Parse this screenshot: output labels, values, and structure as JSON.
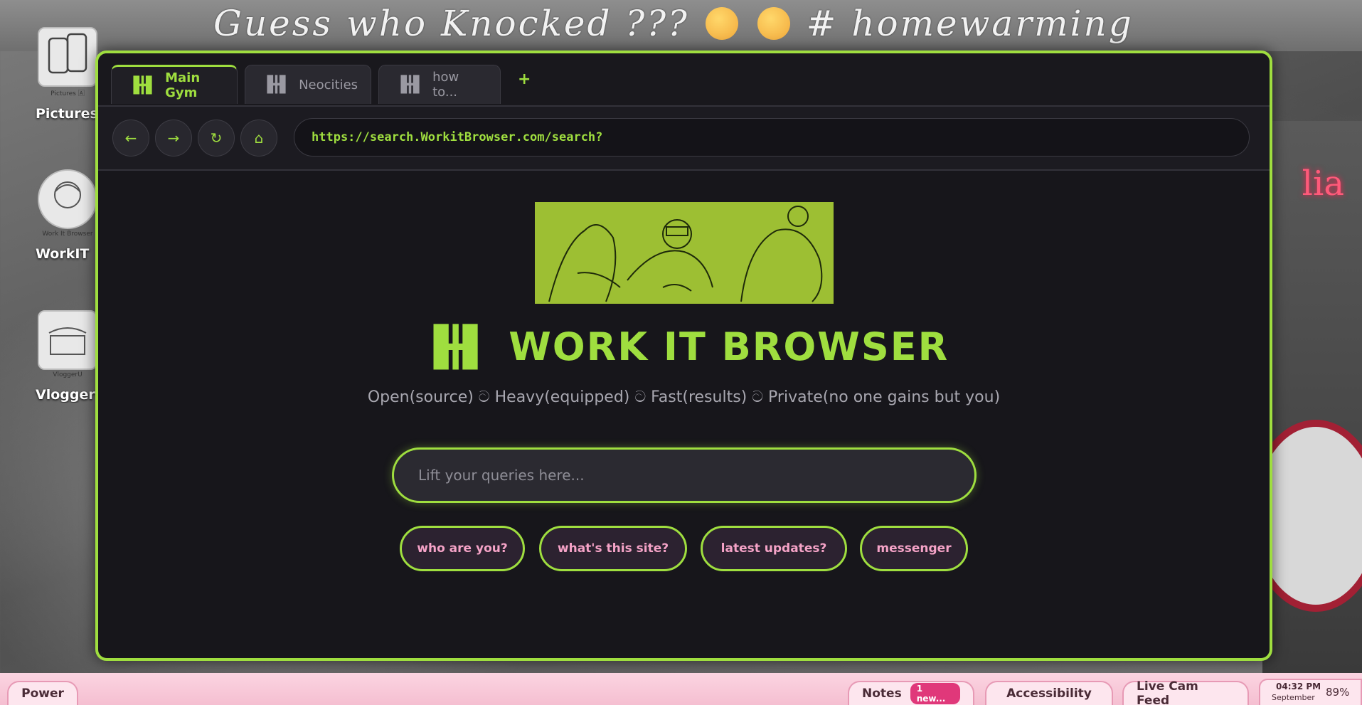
{
  "banner": {
    "text_before": "Guess who Knocked ???",
    "text_after": "# homewarming"
  },
  "desktop": {
    "icons": [
      {
        "label": "Pictures",
        "sub": "Pictures 🄰",
        "icon": "phones-icon"
      },
      {
        "label": "WorkIT",
        "sub": "Work It Browser",
        "icon": "workit-icon"
      },
      {
        "label": "VloggerU",
        "sub": "VloggerU",
        "icon": "vlogger-icon"
      }
    ]
  },
  "browser": {
    "tabs": [
      {
        "label": "Main Gym",
        "active": true
      },
      {
        "label": "Neocities",
        "active": false
      },
      {
        "label": "how to...",
        "active": false
      }
    ],
    "tab_add": "+",
    "tab_icon": "▐╋▌",
    "nav": {
      "back": "←",
      "forward": "→",
      "reload": "↻",
      "home": "⌂"
    },
    "url": "https://search.WorkitBrowser.com/search?",
    "logo_icon": "▐╋▌",
    "title": "WORK IT BROWSER",
    "tagline": "Open(source) ට Heavy(equipped) ට Fast(results) ට Private(no one gains but you)",
    "search_placeholder": "Lift your queries here...",
    "quick_links": [
      "who are you?",
      "what's this site?",
      "latest updates?",
      "messenger"
    ]
  },
  "taskbar": {
    "power": "Power",
    "notes": "Notes",
    "notes_badge": "1 new...",
    "accessibility": "Accessibility",
    "live_cam": "Live Cam Feed",
    "time": "04:32 PM",
    "date": "September",
    "battery": "89%"
  },
  "colors": {
    "accent": "#9fde3f",
    "window_bg": "#17161b",
    "quick_text": "#f5a3c7",
    "taskbar": "#f5bfd1"
  }
}
